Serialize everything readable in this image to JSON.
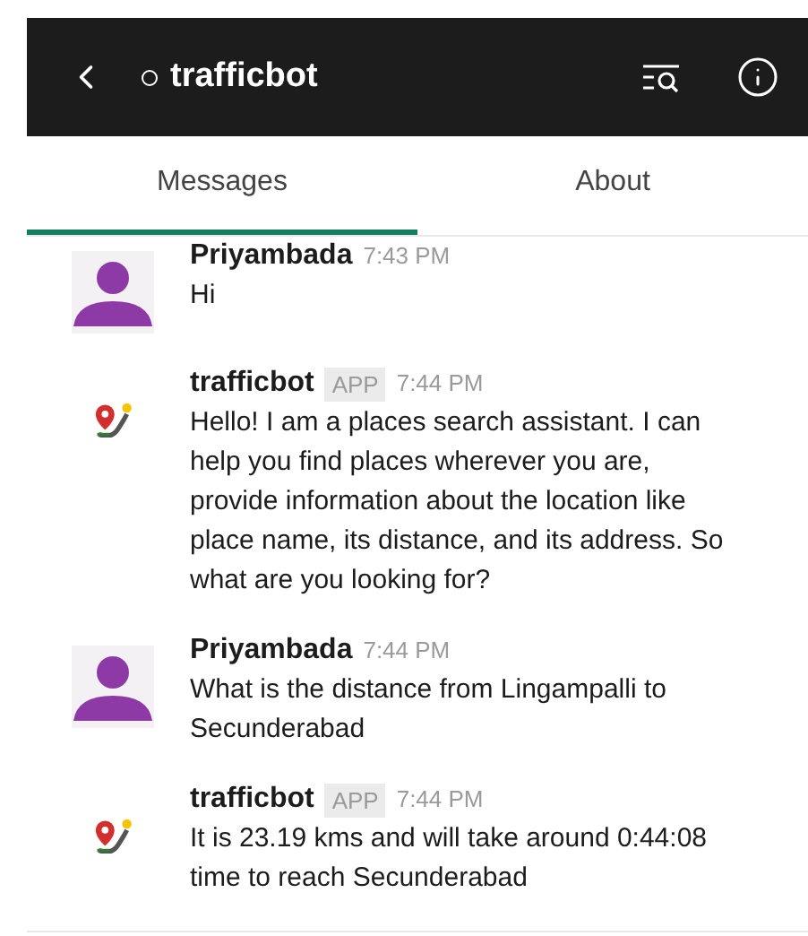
{
  "header": {
    "channel": "trafficbot",
    "online": false
  },
  "tabs": [
    {
      "label": "Messages",
      "selected": true
    },
    {
      "label": "About",
      "selected": false
    }
  ],
  "messages": [
    {
      "kind": "user",
      "author": "Priyambada",
      "time": "7:43 PM",
      "text": "Hi"
    },
    {
      "kind": "app",
      "author": "trafficbot",
      "badge": "APP",
      "time": "7:44 PM",
      "text": "Hello! I am a places search assistant. I can help you find places wherever you are, provide information about the location like place name, its distance, and its address. So what are you looking for?"
    },
    {
      "kind": "user",
      "author": "Priyambada",
      "time": "7:44 PM",
      "text": "What is the distance from Lingampalli to Secunderabad"
    },
    {
      "kind": "app",
      "author": "trafficbot",
      "badge": "APP",
      "time": "7:44 PM",
      "text": "It is 23.19 kms and will take around 0:44:08 time to reach Secunderabad"
    }
  ]
}
